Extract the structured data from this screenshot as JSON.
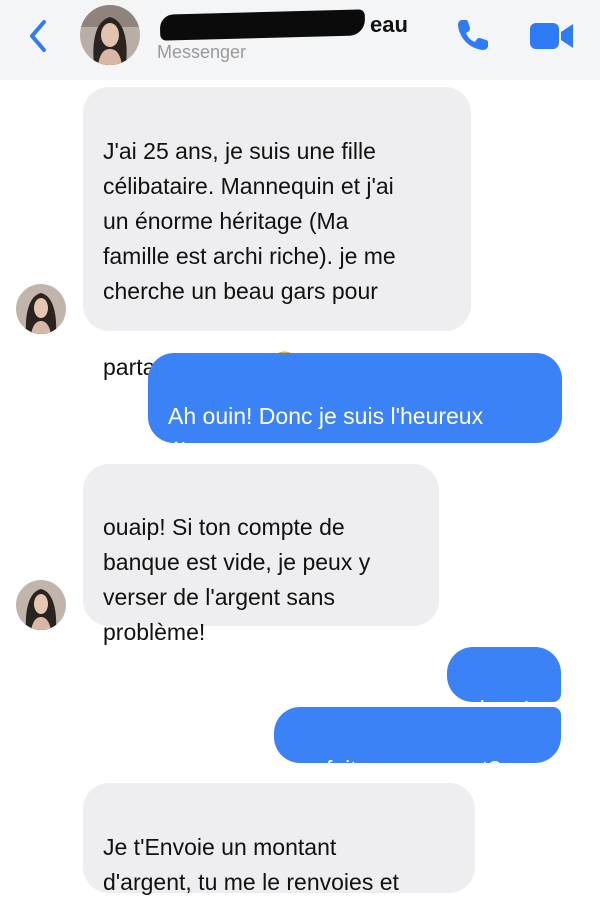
{
  "header": {
    "name_visible_part": "eau",
    "subtitle": "Messenger"
  },
  "colors": {
    "accent": "#2f7bf5",
    "incoming_bubble": "#eeeef0",
    "outgoing_bubble": "#3b82f6"
  },
  "icons": [
    "back-chevron-icon",
    "phone-icon",
    "video-camera-icon",
    "smiley-emoji-icon"
  ],
  "messages": [
    {
      "from": "them",
      "text": "J'ai 25 ans, je suis une fille\ncélibataire. Mannequin et j'ai\nun énorme héritage (Ma\nfamille est archi riche). je me\ncherche un beau gars pour",
      "text_last_line": "partager tout ça",
      "emoji": "slightly-smiling-face"
    },
    {
      "from": "me",
      "text": "Ah ouin! Donc je suis l'heureux\nélu?"
    },
    {
      "from": "them",
      "text": "ouaip! Si ton compte de\nbanque est vide, je peux y\nverser de l'argent sans\nproblème!"
    },
    {
      "from": "me",
      "text": "ok go!"
    },
    {
      "from": "me",
      "text": "on fait ça comment?"
    },
    {
      "from": "them",
      "text": "Je t'Envoie un montant\nd'argent, tu me le renvoies et"
    }
  ]
}
